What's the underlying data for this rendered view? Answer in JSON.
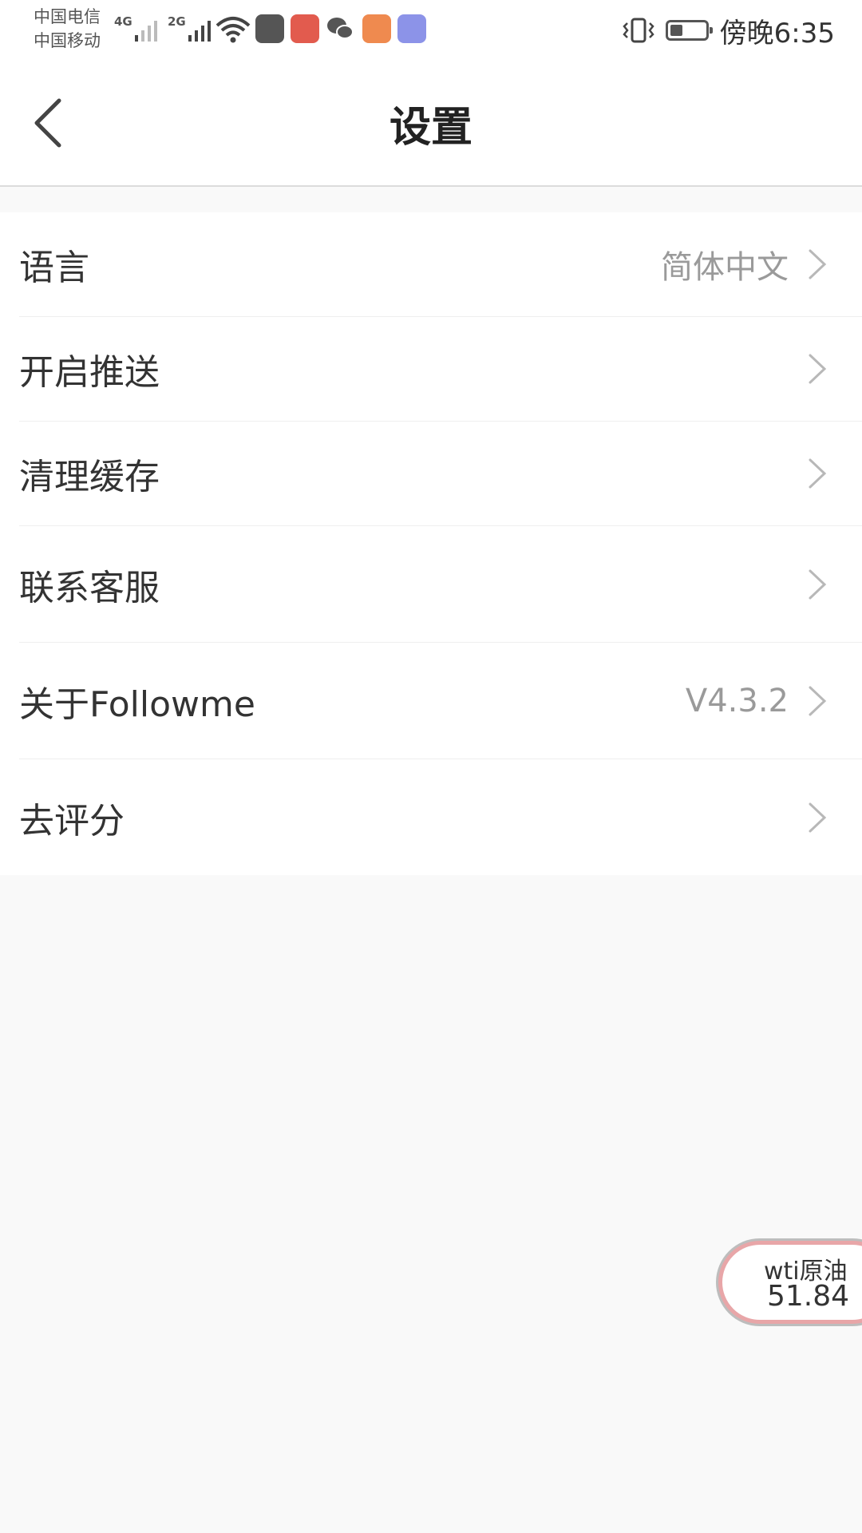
{
  "status_bar": {
    "carrier_1": "中国电信",
    "carrier_2": "中国移动",
    "signal_1_tag": "4G",
    "signal_2_tag": "2G",
    "notification_icons": [
      "du-map-icon",
      "red-app-icon",
      "wechat-icon",
      "health-app-icon",
      "blue-app-icon"
    ],
    "battery_level": 0.35,
    "time": "傍晚6:35"
  },
  "header": {
    "title": "设置"
  },
  "settings": {
    "items": [
      {
        "label": "语言",
        "value": "简体中文"
      },
      {
        "label": "开启推送",
        "value": ""
      },
      {
        "label": "清理缓存",
        "value": ""
      },
      {
        "label": "联系客服",
        "value": ""
      },
      {
        "label": "关于Followme",
        "value": "V4.3.2"
      },
      {
        "label": "去评分",
        "value": ""
      }
    ]
  },
  "ticker": {
    "name": "wti原油",
    "price": "51.84"
  },
  "colors": {
    "background": "#f9f9f9",
    "ticker_border": "#e8a6a8",
    "value_gray": "#9a9a9a"
  }
}
